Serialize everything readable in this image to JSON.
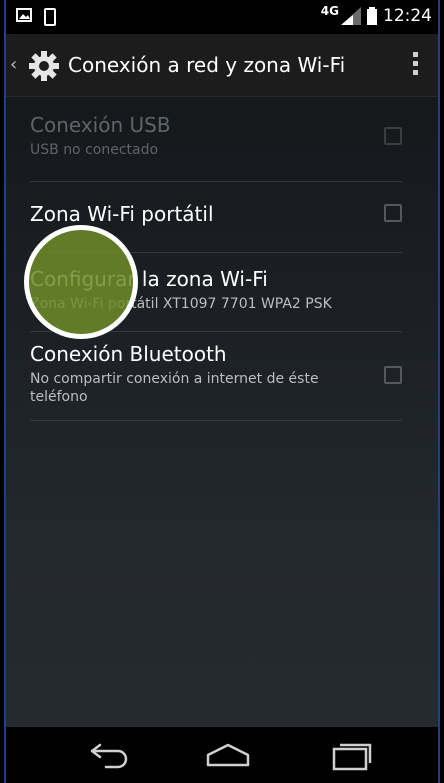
{
  "status_bar": {
    "network": "4G",
    "time": "12:24"
  },
  "action_bar": {
    "title": "Conexión a red y zona Wi-Fi"
  },
  "preferences": [
    {
      "title": "Conexión USB",
      "summary": "USB no conectado",
      "enabled": false,
      "checked": false
    },
    {
      "title": "Zona Wi-Fi portátil",
      "summary": "",
      "enabled": true,
      "checked": false
    },
    {
      "title": "Configurar la zona Wi-Fi",
      "summary": "Zona Wi-Fi portátil XT1097 7701 WPA2 PSK",
      "enabled": true
    },
    {
      "title": "Conexión Bluetooth",
      "summary": "No compartir conexión a internet de éste teléfono",
      "enabled": true,
      "checked": false
    }
  ],
  "icons": {
    "back": "back-arrow-icon",
    "settings": "gear-icon",
    "overflow": "overflow-menu-icon",
    "nav_back": "nav-back-icon",
    "nav_home": "nav-home-icon",
    "nav_recents": "nav-recents-icon"
  },
  "colors": {
    "touch_highlight": "#6e8c28",
    "frame_border": "#1f3f8a"
  }
}
